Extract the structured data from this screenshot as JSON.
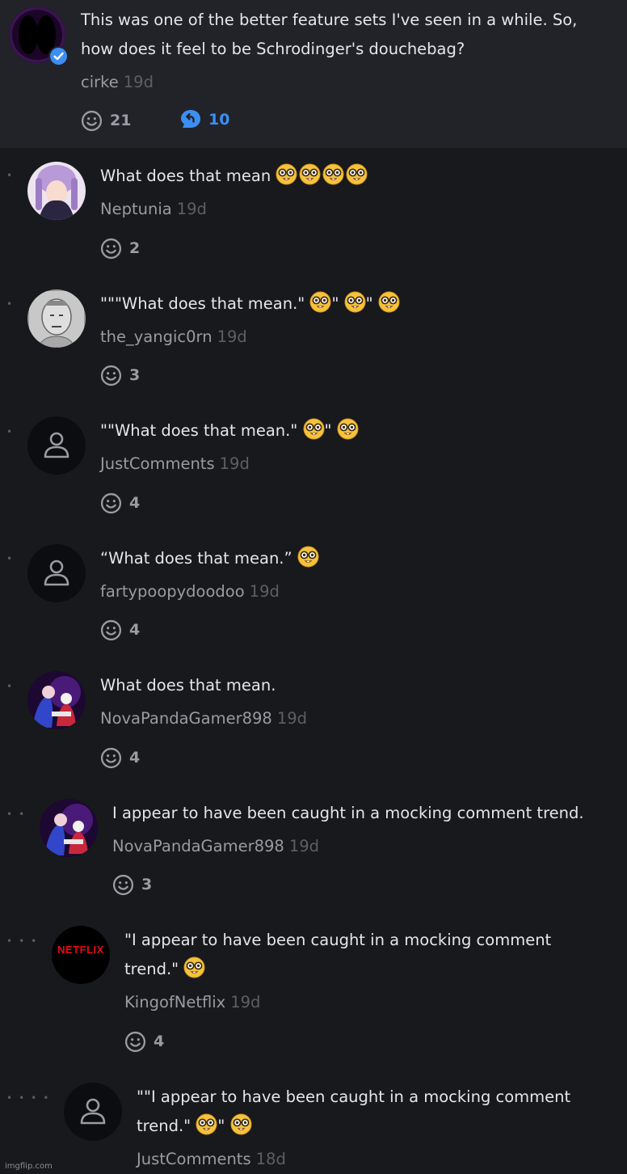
{
  "top_comment": {
    "text_line1": "This was one of the better feature sets I've seen in a while. So,",
    "text_line2": "how does it feel to be Schrodinger's douchebag?",
    "username": "cirke",
    "time": "19d",
    "reactions": "21",
    "replies": "10"
  },
  "replies": [
    {
      "text": "What does that mean",
      "username": "Neptunia",
      "time": "19d",
      "reactions": "2"
    },
    {
      "text": "\"\"\"What does that mean.\"",
      "tail": "\"",
      "username": "the_yangic0rn",
      "time": "19d",
      "reactions": "3"
    },
    {
      "text": "\"\"What does that mean.\"",
      "tail": "\"",
      "username": "JustComments",
      "time": "19d",
      "reactions": "4"
    },
    {
      "text": "“What does that mean.”",
      "username": "fartypoopydoodoo",
      "time": "19d",
      "reactions": "4"
    },
    {
      "text": "What does that mean.",
      "username": "NovaPandaGamer898",
      "time": "19d",
      "reactions": "4"
    },
    {
      "text": "I appear to have been caught in a mocking comment trend.",
      "username": "NovaPandaGamer898",
      "time": "19d",
      "reactions": "3"
    },
    {
      "text_line1": "\"I appear to have been caught in a mocking comment",
      "text_line2": "trend.\"",
      "username": "KingofNetflix",
      "time": "19d",
      "reactions": "4",
      "avatar_text": "NETFLIX"
    },
    {
      "text_line1": "\"\"I appear to have been caught in a mocking comment",
      "text_line2": "trend.\"",
      "tail": "\"",
      "username": "JustComments",
      "time": "18d"
    }
  ],
  "watermark": "imgflip.com",
  "colors": {
    "background": "#18191d",
    "top_background": "#222329",
    "accent": "#3b8ff3"
  }
}
